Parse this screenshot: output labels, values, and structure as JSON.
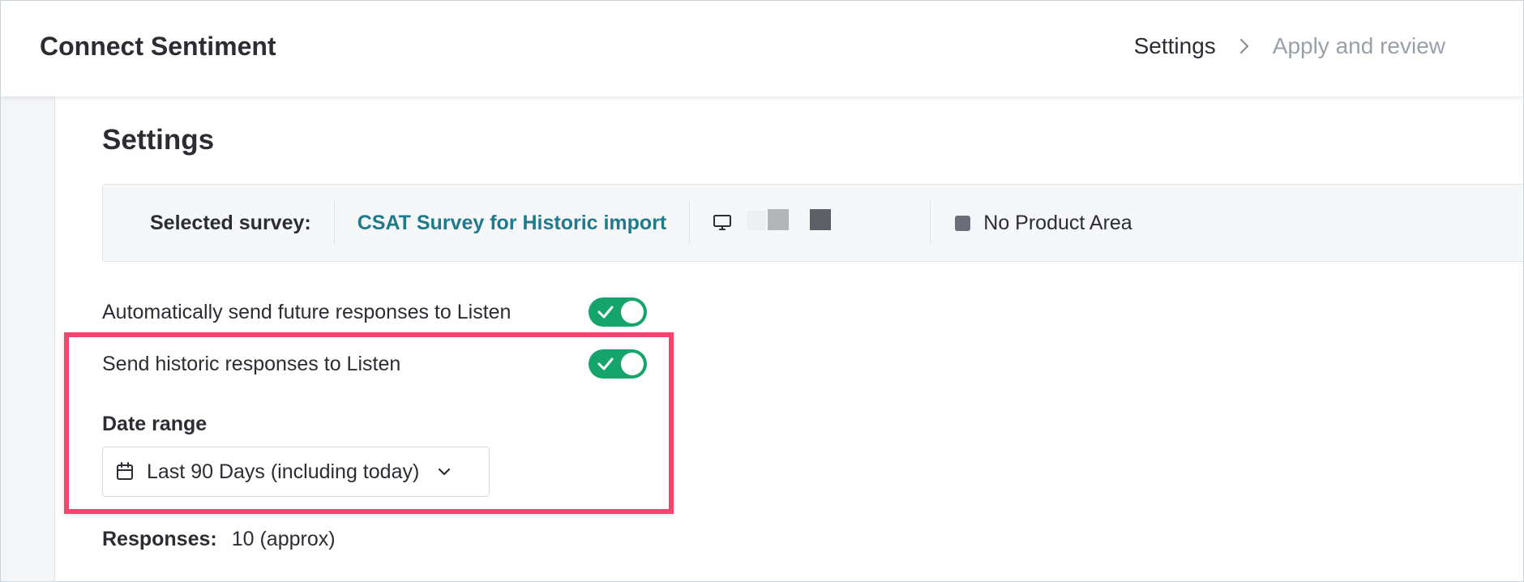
{
  "header": {
    "title": "Connect Sentiment",
    "breadcrumb": [
      "Settings",
      "Apply and review"
    ]
  },
  "main": {
    "page_title": "Settings",
    "survey_bar": {
      "label": "Selected survey:",
      "survey_name": "CSAT Survey for Historic import",
      "channel_icon": "monitor-icon",
      "product_area": "No Product Area"
    },
    "auto_send": {
      "label": "Automatically send future responses to Listen",
      "enabled": true
    },
    "historic_send": {
      "label": "Send historic responses to Listen",
      "enabled": true
    },
    "date_range": {
      "label": "Date range",
      "selected": "Last 90 Days (including today)"
    },
    "responses": {
      "label": "Responses:",
      "value": "10 (approx)"
    }
  },
  "colors": {
    "accent_teal": "#1f7a8c",
    "toggle_green": "#14a46c",
    "highlight_pink": "#f2466f"
  }
}
